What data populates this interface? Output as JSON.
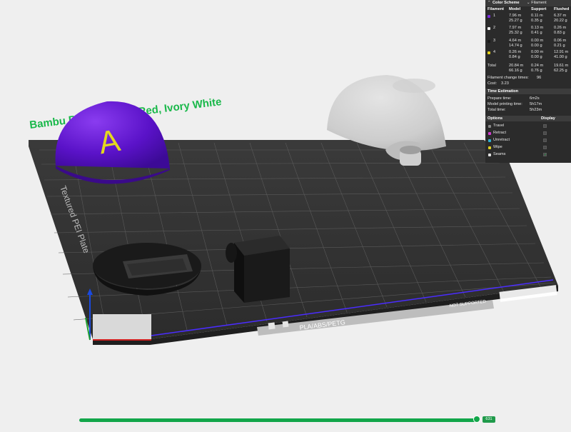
{
  "plate": {
    "title_text": "Bambu Basic Scarlet Red, Ivory White",
    "plate_label": "Textured PEI Plate",
    "bottom_label": "PLA/ABS/PETG",
    "bottom_right_label": "NOT SUPPORTED"
  },
  "model": {
    "dome_letter": "A"
  },
  "panel": {
    "color_scheme_label": "Color Scheme",
    "color_scheme_value": "Filament",
    "headers": {
      "filament": "Filament",
      "model": "Model",
      "support": "Support",
      "flushed": "Flushed"
    },
    "filaments": [
      {
        "id": "1",
        "color": "#7a2be0",
        "model_len": "7.96 m",
        "model_wt": "25.27 g",
        "support_len": "0.11 m",
        "support_wt": "0.35 g",
        "flushed_len": "6.37 m",
        "flushed_wt": "20.22 g"
      },
      {
        "id": "2",
        "color": "#f2f2f2",
        "model_len": "7.97 m",
        "model_wt": "25.32 g",
        "support_len": "0.13 m",
        "support_wt": "0.41 g",
        "flushed_len": "0.26 m",
        "flushed_wt": "0.83 g"
      },
      {
        "id": "3",
        "color": "#1a1a1a",
        "model_len": "4.64 m",
        "model_wt": "14.74 g",
        "support_len": "0.00 m",
        "support_wt": "0.00 g",
        "flushed_len": "0.06 m",
        "flushed_wt": "0.21 g"
      },
      {
        "id": "4",
        "color": "#e6d21a",
        "model_len": "0.26 m",
        "model_wt": "0.84 g",
        "support_len": "0.00 m",
        "support_wt": "0.00 g",
        "flushed_len": "12.91 m",
        "flushed_wt": "41.00 g"
      }
    ],
    "total": {
      "label": "Total",
      "model_len": "20.84 m",
      "model_wt": "66.16 g",
      "support_len": "0.24 m",
      "support_wt": "0.76 g",
      "flushed_len": "19.61 m",
      "flushed_wt": "62.25 g"
    },
    "change_times_label": "Filament change times:",
    "change_times_value": "96",
    "cost_label": "Cost:",
    "cost_value": "3.23",
    "time_section_label": "Time Estimation",
    "prepare_label": "Prepare time:",
    "prepare_value": "6m2s",
    "model_print_label": "Model printing time:",
    "model_print_value": "5h17m",
    "total_time_label": "Total time:",
    "total_time_value": "5h23m",
    "options_label": "Options",
    "display_label": "Display",
    "options": [
      {
        "name": "Travel",
        "color": "#888888",
        "checked": false
      },
      {
        "name": "Retract",
        "color": "#d03ad0",
        "checked": false
      },
      {
        "name": "Unretract",
        "color": "#2fb0d0",
        "checked": false
      },
      {
        "name": "Wipe",
        "color": "#e0d020",
        "checked": false
      },
      {
        "name": "Seams",
        "color": "#e0e0e0",
        "checked": true
      }
    ]
  },
  "slider": {
    "value": "631",
    "fraction": 0.99
  }
}
